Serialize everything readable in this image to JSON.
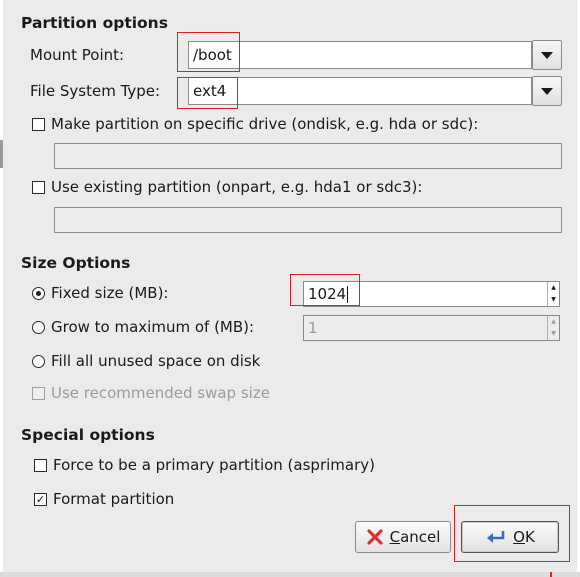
{
  "partition": {
    "title": "Partition options",
    "mount_point_label": "Mount Point:",
    "mount_point_value": "/boot",
    "fs_type_label": "File System Type:",
    "fs_type_value": "ext4",
    "specific_drive_label": "Make partition on specific drive (ondisk, e.g. hda or sdc):",
    "existing_partition_label": "Use existing partition (onpart, e.g. hda1 or sdc3):"
  },
  "size": {
    "title": "Size Options",
    "fixed_label": "Fixed size (MB):",
    "fixed_value": "1024",
    "grow_label": "Grow to maximum of (MB):",
    "grow_value": "1",
    "fill_label": "Fill all unused space on disk",
    "swap_label": "Use recommended swap size"
  },
  "special": {
    "title": "Special options",
    "primary_label": "Force to be a primary partition (asprimary)",
    "format_label": "Format partition"
  },
  "buttons": {
    "cancel_first": "C",
    "cancel_rest": "ancel",
    "ok_first": "O",
    "ok_rest": "K"
  },
  "icons": {
    "cancel": "red-x-icon",
    "ok": "return-arrow-icon",
    "dropdown": "triangle-down-icon"
  },
  "colors": {
    "dialog_bg": "#ebebeb",
    "highlight": "#e02020",
    "cancel_icon": "#d93030",
    "ok_icon": "#3a6fb8"
  }
}
